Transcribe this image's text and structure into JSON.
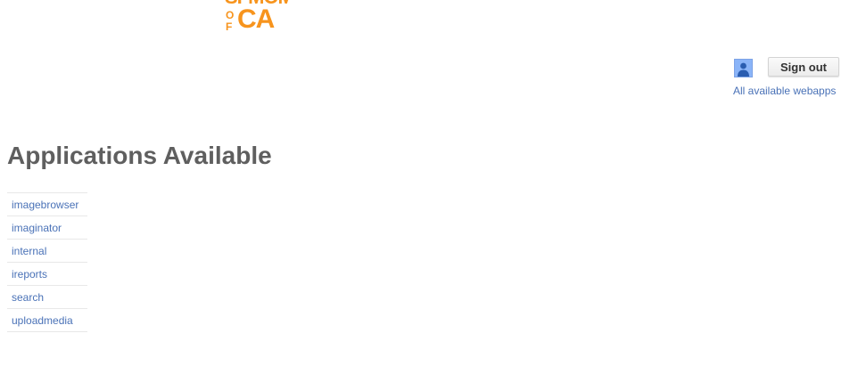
{
  "logo": {
    "top_text": "SFMOMA",
    "small_letters": [
      "O",
      "F"
    ],
    "big_text": "CA",
    "color": "#f7941d"
  },
  "user": {
    "avatar_icon": "user-avatar-icon",
    "signout_label": "Sign out",
    "all_webapps_link": "All available webapps"
  },
  "main": {
    "heading": "Applications Available",
    "apps": [
      {
        "label": "imagebrowser"
      },
      {
        "label": "imaginator"
      },
      {
        "label": "internal"
      },
      {
        "label": "ireports"
      },
      {
        "label": "search"
      },
      {
        "label": "uploadmedia"
      }
    ]
  },
  "colors": {
    "link": "#4a72b7",
    "heading": "#5f5f5f",
    "brand": "#f7941d"
  }
}
